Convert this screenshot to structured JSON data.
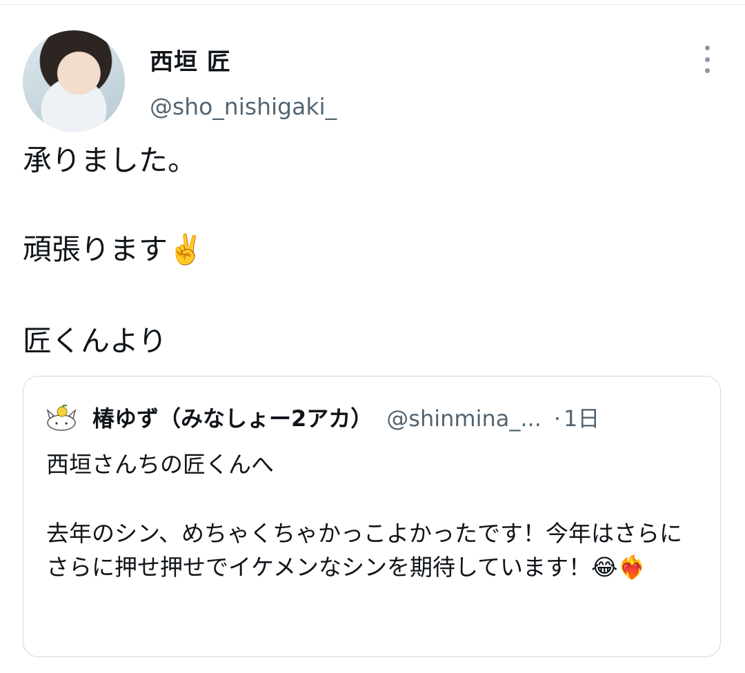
{
  "tweet": {
    "author_name": "西垣 匠",
    "author_handle": "@sho_nishigaki_",
    "avatar_icon": "user-avatar-photo",
    "more_icon": "more-options-icon",
    "lines": [
      "承りました。",
      "頑張ります✌️",
      "匠くんより"
    ]
  },
  "quoted_tweet": {
    "author_name": "椿ゆず（みなしょー2アカ）",
    "author_handle": "@shinmina_...",
    "separator": "·",
    "timestamp": "1日",
    "avatar_icon": "cat-avatar-icon",
    "paragraphs": [
      "西垣さんちの匠くんへ",
      "去年のシン、めちゃくちゃかっこよかったです！今年はさらにさらに押せ押せでイケメンなシンを期待しています！😂❤️‍🔥"
    ]
  },
  "colors": {
    "text": "#0f1419",
    "secondary": "#536471",
    "border": "#cfd9de"
  }
}
